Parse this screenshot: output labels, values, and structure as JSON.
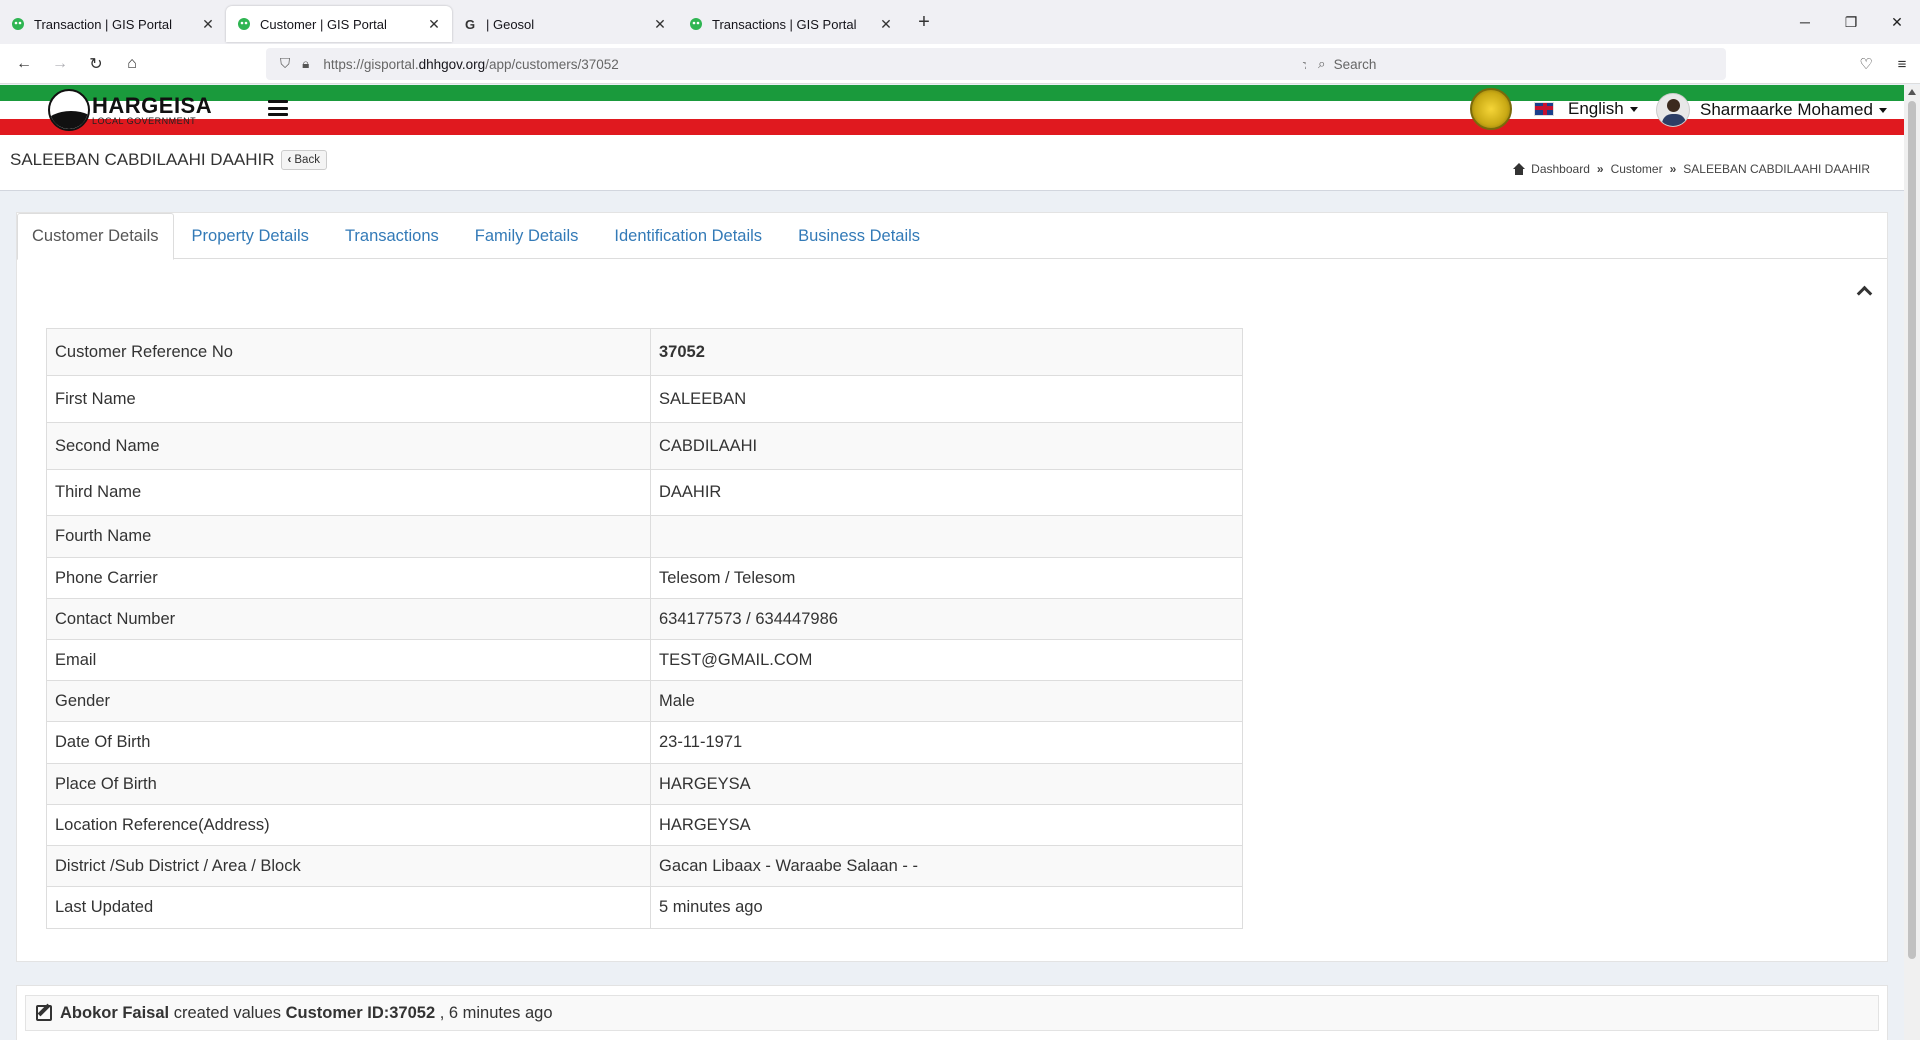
{
  "browser": {
    "tabs": [
      {
        "title": "Transaction | GIS Portal",
        "favicon": "gis-favicon",
        "active": false
      },
      {
        "title": "Customer | GIS Portal",
        "favicon": "gis-favicon",
        "active": true
      },
      {
        "title": "| Geosol",
        "favicon": "google-favicon",
        "active": false
      },
      {
        "title": "Transactions | GIS Portal",
        "favicon": "gis-favicon",
        "active": false
      }
    ],
    "url_prefix": "https://gisportal.",
    "url_host": "dhhgov.org",
    "url_path": "/app/customers/37052",
    "search_placeholder": "Search"
  },
  "header": {
    "logo_main": "HARGEISA",
    "logo_sub": "LOCAL GOVERNMENT",
    "language": "English",
    "user_name": "Sharmaarke Mohamed",
    "colors": {
      "green": "#1a9a3c",
      "white": "#ffffff",
      "red": "#e0191f"
    }
  },
  "page": {
    "title": "SALEEBAN CABDILAAHI DAAHIR",
    "back_label": "Back",
    "breadcrumb": [
      "Dashboard",
      "Customer",
      "SALEEBAN CABDILAAHI DAAHIR"
    ]
  },
  "tabs": [
    {
      "label": "Customer Details",
      "active": true
    },
    {
      "label": "Property Details",
      "active": false
    },
    {
      "label": "Transactions",
      "active": false
    },
    {
      "label": "Family Details",
      "active": false
    },
    {
      "label": "Identification Details",
      "active": false
    },
    {
      "label": "Business Details",
      "active": false
    }
  ],
  "details": [
    {
      "label": "Customer Reference No",
      "value": "37052",
      "bold": true
    },
    {
      "label": "First Name",
      "value": "SALEEBAN"
    },
    {
      "label": "Second Name",
      "value": "CABDILAAHI"
    },
    {
      "label": "Third Name",
      "value": "DAAHIR"
    },
    {
      "label": "Fourth Name",
      "value": ""
    },
    {
      "label": "Phone Carrier",
      "value": "Telesom / Telesom"
    },
    {
      "label": "Contact Number",
      "value": "634177573 / 634447986"
    },
    {
      "label": "Email",
      "value": "TEST@GMAIL.COM"
    },
    {
      "label": "Gender",
      "value": "Male"
    },
    {
      "label": "Date Of Birth",
      "value": "23-11-1971"
    },
    {
      "label": "Place Of Birth",
      "value": "HARGEYSA"
    },
    {
      "label": "Location Reference(Address)",
      "value": "HARGEYSA"
    },
    {
      "label": "District /Sub District / Area / Block",
      "value": "Gacan Libaax - Waraabe Salaan - -"
    },
    {
      "label": "Last Updated",
      "value": "5 minutes ago"
    }
  ],
  "activity": {
    "user": "Abokor Faisal",
    "action": "created values",
    "target": "Customer ID:37052",
    "time": ", 6 minutes ago"
  }
}
